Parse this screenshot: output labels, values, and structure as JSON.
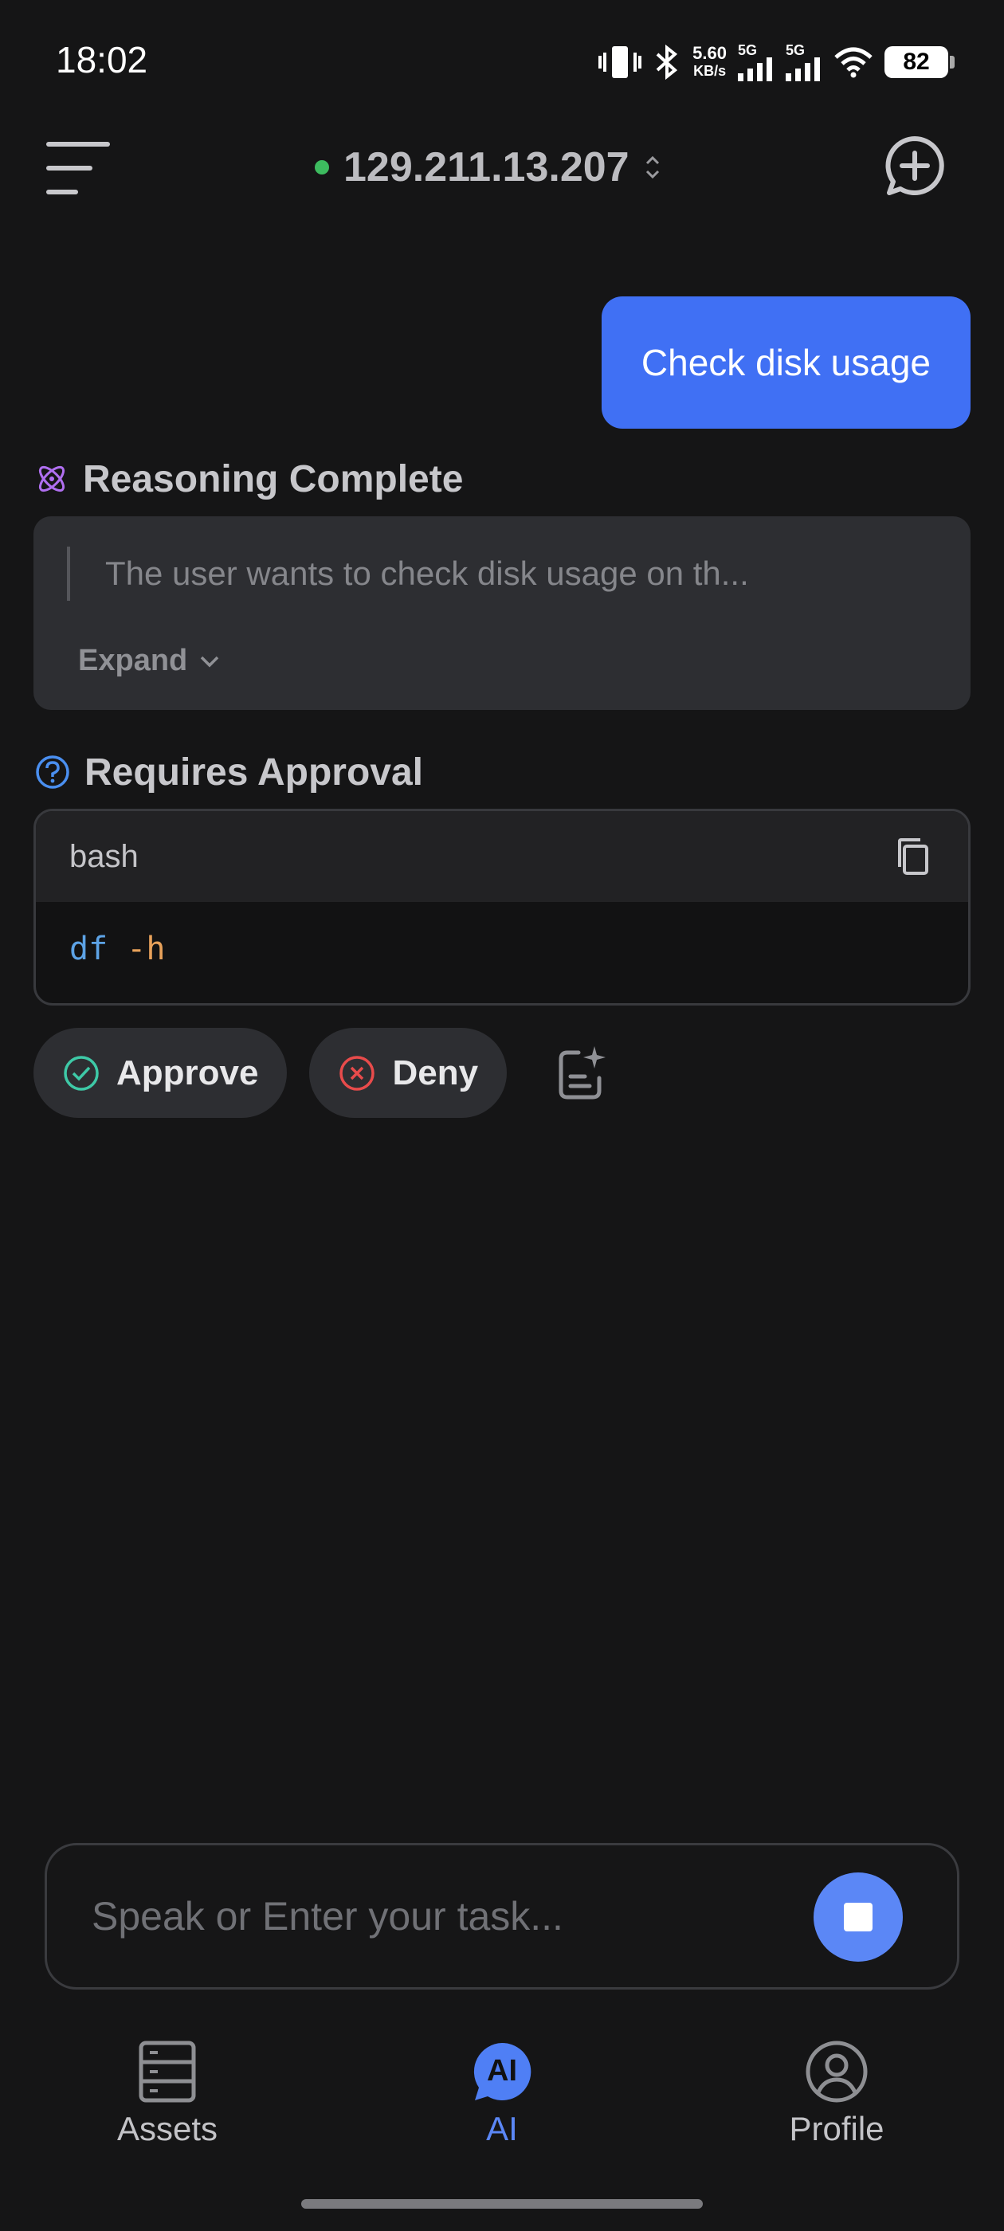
{
  "status_bar": {
    "time": "18:02",
    "net_speed_value": "5.60",
    "net_speed_unit": "KB/s",
    "sim1_label": "5G",
    "sim2_label": "5G",
    "battery": "82"
  },
  "header": {
    "host_ip": "129.211.13.207",
    "connection_status_color": "#3dbb5f"
  },
  "chat": {
    "user_message": "Check disk usage",
    "reasoning": {
      "title": "Reasoning Complete",
      "preview": "The user wants to check disk usage on th...",
      "expand_label": "Expand"
    },
    "approval": {
      "title": "Requires Approval",
      "language": "bash",
      "command": "df",
      "flag": "-h",
      "approve_label": "Approve",
      "deny_label": "Deny"
    }
  },
  "composer": {
    "placeholder": "Speak or Enter your task..."
  },
  "bottom_nav": {
    "tabs": [
      {
        "label": "Assets",
        "icon": "server-icon"
      },
      {
        "label": "AI",
        "icon": "ai-chat-icon",
        "badge": "AI",
        "active": true
      },
      {
        "label": "Profile",
        "icon": "profile-icon"
      }
    ]
  },
  "colors": {
    "accent": "#4070f4",
    "background": "#151516",
    "approve": "#3ec9a7",
    "deny": "#e84b4b",
    "reasoning_icon": "#b06ff0",
    "help_icon": "#4a8ff0"
  }
}
